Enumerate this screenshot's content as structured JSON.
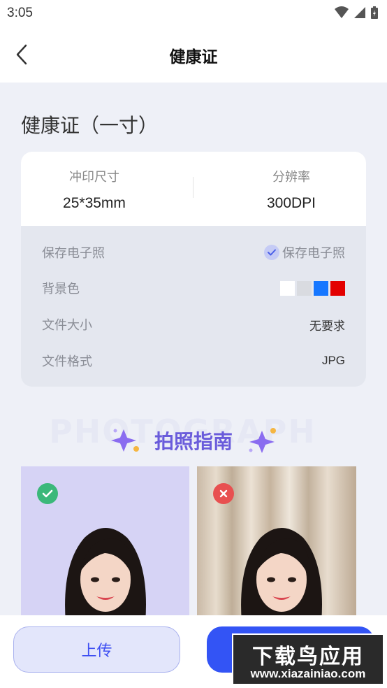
{
  "status_bar": {
    "time": "3:05"
  },
  "nav": {
    "title": "健康证"
  },
  "heading": "健康证（一寸）",
  "specs": {
    "print_size_label": "冲印尺寸",
    "print_size_value": "25*35mm",
    "resolution_label": "分辨率",
    "resolution_value": "300DPI"
  },
  "details": {
    "save_label": "保存电子照",
    "save_option": "保存电子照",
    "background_label": "背景色",
    "background_colors": [
      "#ffffff",
      "#d9dbe0",
      "#1677ff",
      "#e30000"
    ],
    "file_size_label": "文件大小",
    "file_size_value": "无要求",
    "file_format_label": "文件格式",
    "file_format_value": "JPG"
  },
  "guide": {
    "watermark": "PHOTOGRAPH",
    "title": "拍照指南"
  },
  "actions": {
    "upload_label": "上传"
  },
  "site_watermark": {
    "main": "下载鸟应用",
    "url": "www.xiazainiao.com"
  },
  "colors": {
    "accent": "#3354f5",
    "guide_title": "#6a5cdb"
  }
}
